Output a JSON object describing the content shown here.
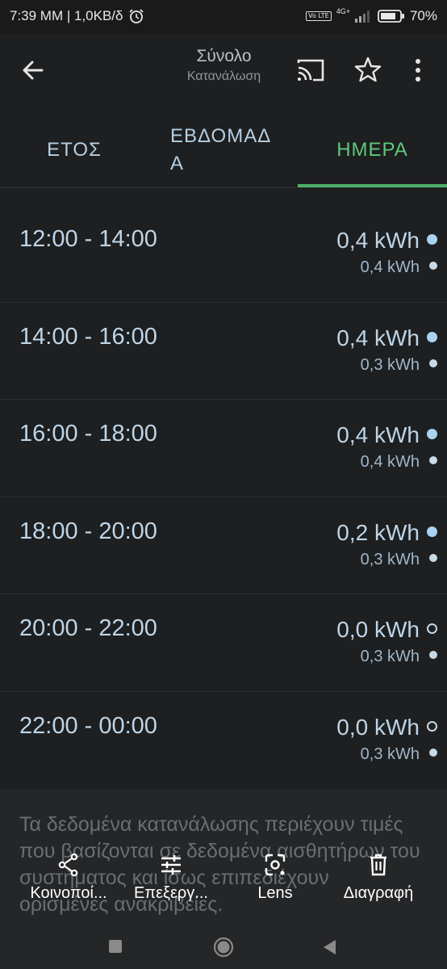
{
  "status_bar": {
    "time_speed": "7:39 ΜΜ | 1,0KB/δ",
    "network_badge": "Vo LTE",
    "network_type": "4G+",
    "battery_percent": "70%",
    "icons": [
      "alarm-icon",
      "volte-icon",
      "signal-icon",
      "battery-icon"
    ]
  },
  "app_bar": {
    "title": "Σύνολο",
    "subtitle": "Κατανάλωση",
    "icons": [
      "back-arrow-icon",
      "cast-icon",
      "star-icon",
      "more-vert-icon"
    ]
  },
  "tabs": [
    {
      "label": "ΕΤΟΣ",
      "selected": false
    },
    {
      "label": "ΕΒΔΟΜΑΔΑ",
      "selected": false
    },
    {
      "label": "ΗΜΕΡΑ",
      "selected": true
    }
  ],
  "colors": {
    "accent_green": "#4caf66",
    "value_blue": "#a8d3f2",
    "background": "#1e1f20"
  },
  "rows": [
    {
      "time": "12:00 - 14:00",
      "value": "0,4 kWh",
      "sub_value": "0,4 kWh",
      "main_dot": "filled"
    },
    {
      "time": "14:00 - 16:00",
      "value": "0,4 kWh",
      "sub_value": "0,3 kWh",
      "main_dot": "filled"
    },
    {
      "time": "16:00 - 18:00",
      "value": "0,4 kWh",
      "sub_value": "0,4 kWh",
      "main_dot": "filled"
    },
    {
      "time": "18:00 - 20:00",
      "value": "0,2 kWh",
      "sub_value": "0,3 kWh",
      "main_dot": "filled"
    },
    {
      "time": "20:00 - 22:00",
      "value": "0,0 kWh",
      "sub_value": "0,3 kWh",
      "main_dot": "empty"
    },
    {
      "time": "22:00 - 00:00",
      "value": "0,0 kWh",
      "sub_value": "0,3 kWh",
      "main_dot": "empty"
    }
  ],
  "note": "Τα δεδομένα κατανάλωσης περιέχουν τιμές που βασίζονται σε δεδομένα αισθητήρων του συστήματος και ίσως επιπεδιέχουν ορισμένες ανακριβείες.",
  "actions": [
    {
      "label": "Κοινοποί...",
      "icon": "share-icon"
    },
    {
      "label": "Επεξεργ...",
      "icon": "tune-icon"
    },
    {
      "label": "Lens",
      "icon": "lens-icon"
    },
    {
      "label": "Διαγραφή",
      "icon": "trash-icon"
    }
  ],
  "nav_bar": {
    "icons": [
      "recents-square-icon",
      "home-circle-icon",
      "back-triangle-icon"
    ]
  }
}
